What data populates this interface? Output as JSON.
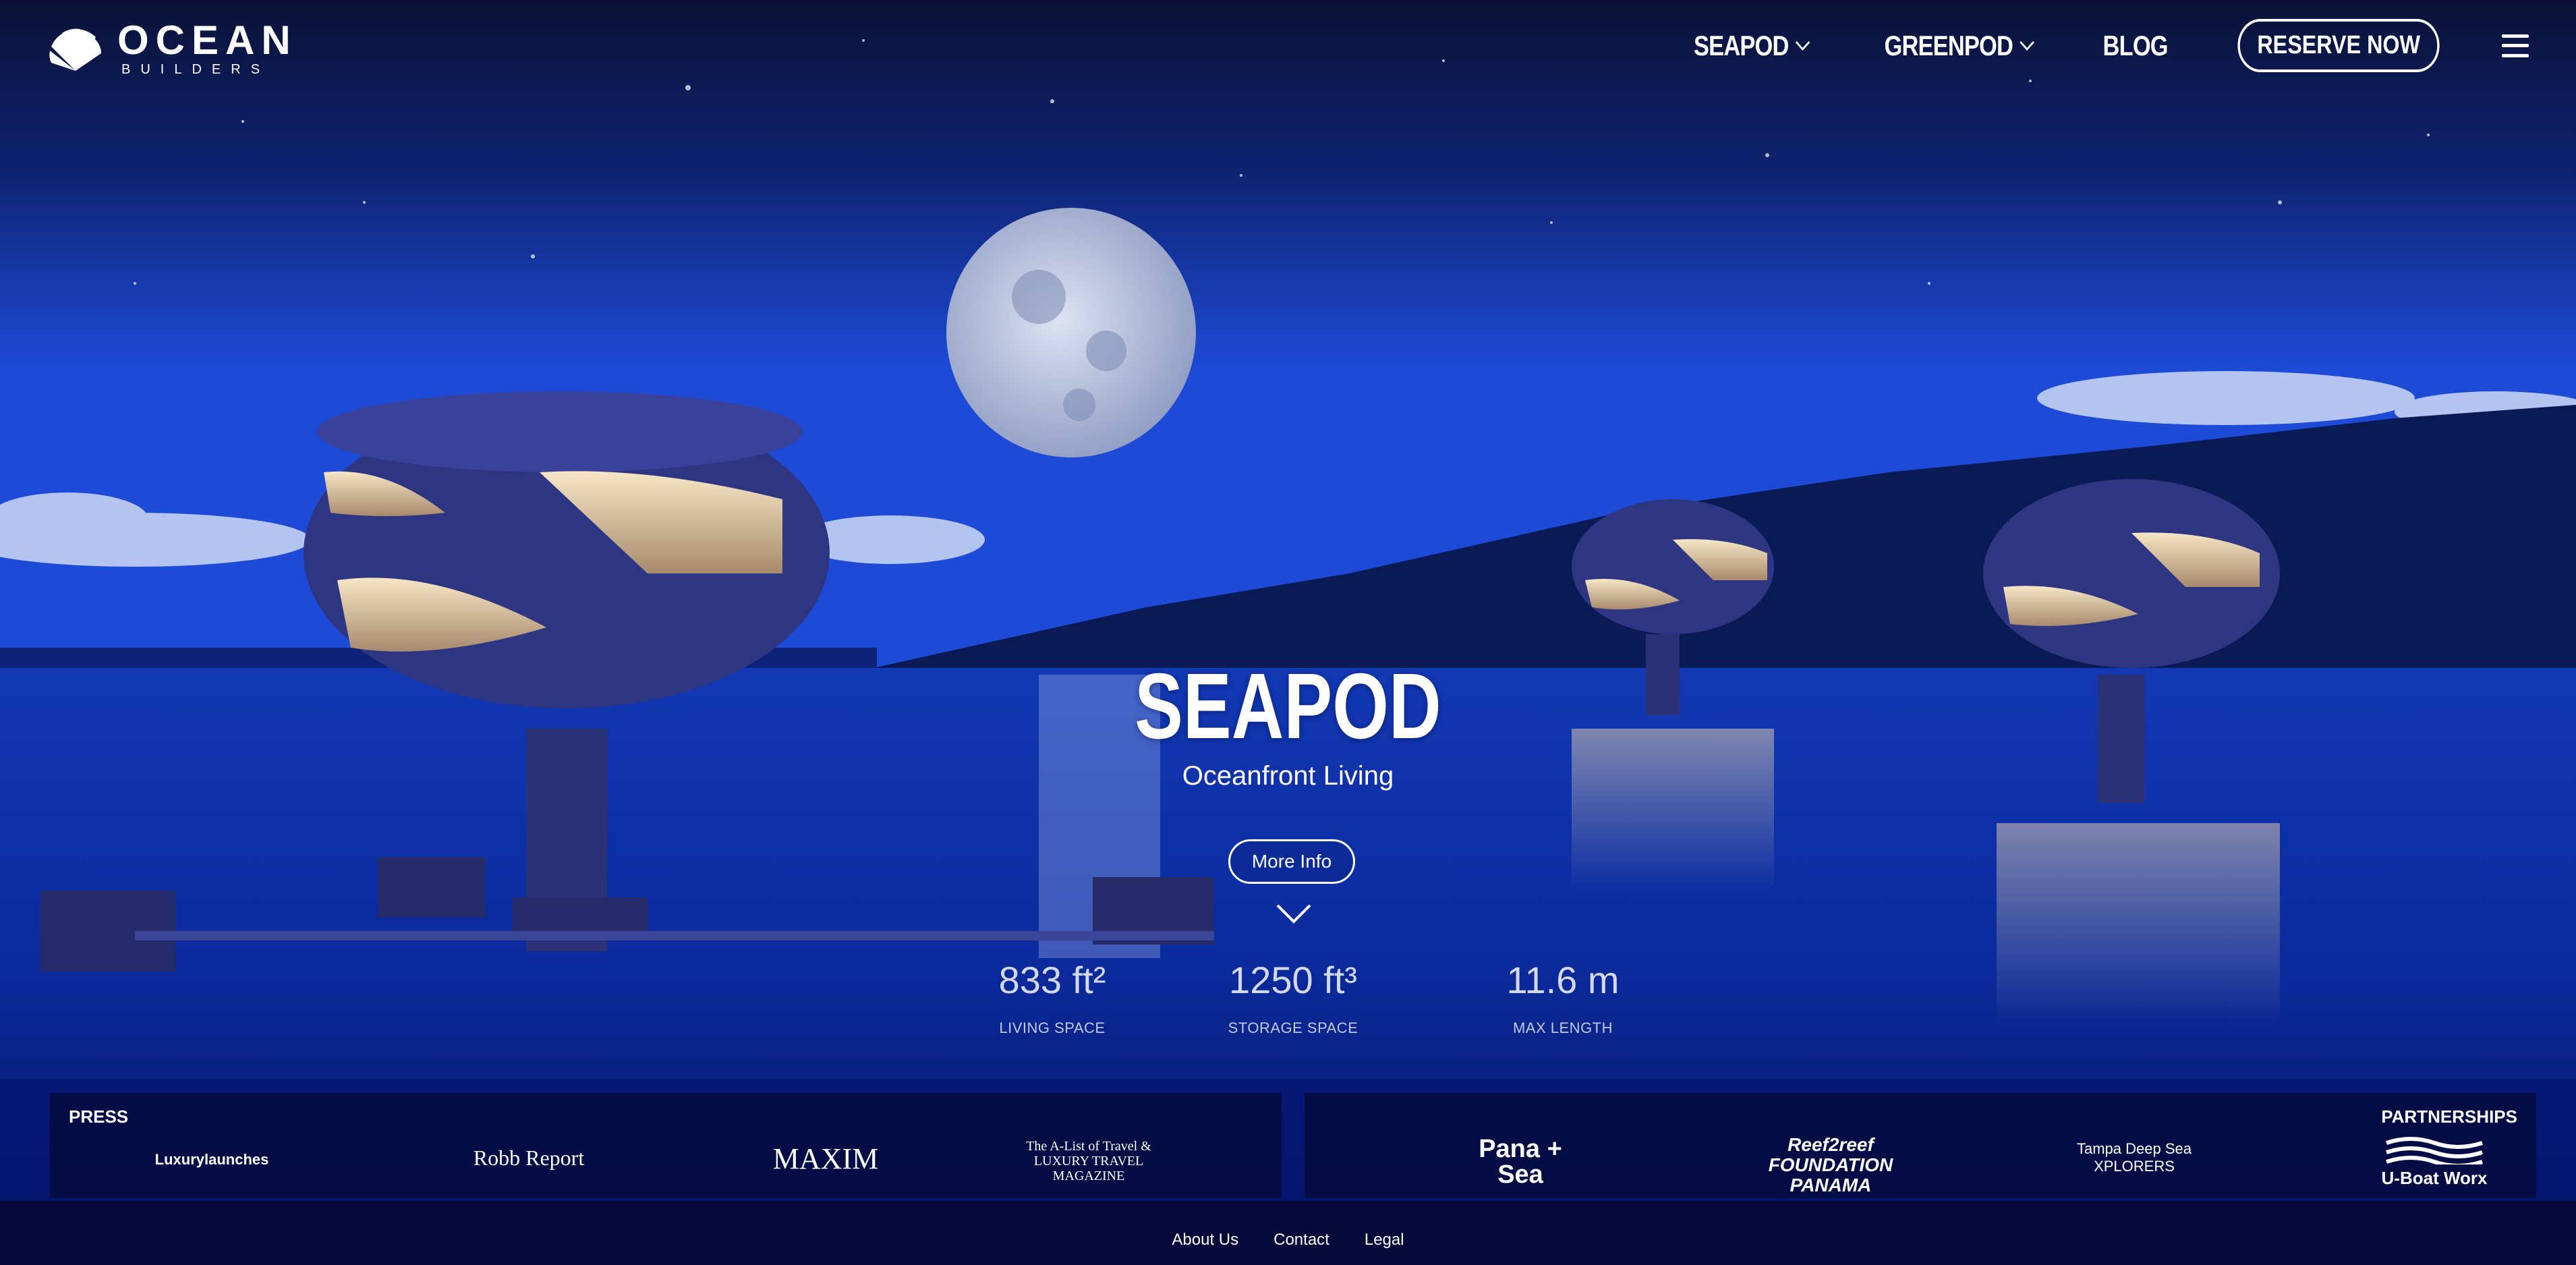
{
  "brand": {
    "name": "OCEAN",
    "sub": "BUILDERS"
  },
  "nav": {
    "items": [
      {
        "label": "SEAPOD"
      },
      {
        "label": "GREENPOD"
      },
      {
        "label": "BLOG"
      }
    ],
    "cta": "RESERVE NOW",
    "menu_icon": "hamburger-icon"
  },
  "hero": {
    "title": "SEAPOD",
    "subtitle": "Oceanfront Living",
    "button": "More Info",
    "scroll_icon": "chevron-down-icon"
  },
  "stats": [
    {
      "value": "833 ft²",
      "label": "LIVING SPACE"
    },
    {
      "value": "1250 ft³",
      "label": "STORAGE SPACE"
    },
    {
      "value": "11.6 m",
      "label": "MAX LENGTH"
    }
  ],
  "press": {
    "title": "PRESS",
    "logos": [
      "Luxurylaunches",
      "Robb Report",
      "MAXIM",
      "The A-List of Travel & LUXURY TRAVEL MAGAZINE"
    ]
  },
  "partnerships": {
    "title": "PARTNERSHIPS",
    "logos": [
      "Pana + Sea",
      "Reef2reef FOUNDATION PANAMA",
      "Tampa Deep Sea XPLORERS",
      "U-Boat Worx"
    ]
  },
  "footer": {
    "links": [
      "About Us",
      "Contact",
      "Legal"
    ]
  },
  "colors": {
    "sky_top": "#0b1440",
    "sky_mid": "#1537b5",
    "water": "#0b2fb8",
    "panel": "#040a3c"
  }
}
